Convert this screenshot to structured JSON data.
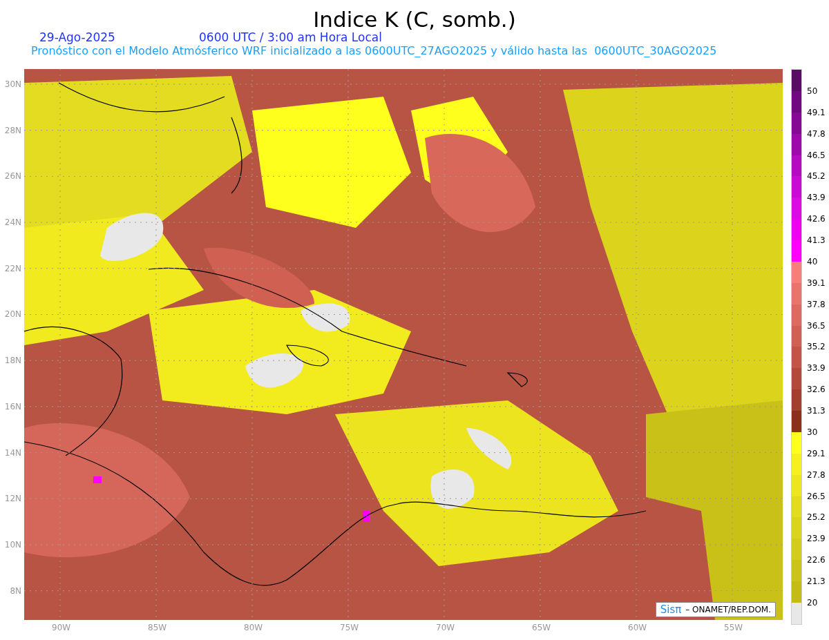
{
  "title": "Indice K (C, somb.)",
  "date": "29-Ago-2025",
  "time": "0600 UTC / 3:00 am Hora Local",
  "subtitle": "Pronóstico con el Modelo Atmósferico WRF inicializado a las 0600UTC_27AGO2025 y válido hasta las  0600UTC_30AGO2025",
  "lat_labels": [
    "30N",
    "28N",
    "26N",
    "24N",
    "22N",
    "20N",
    "18N",
    "16N",
    "14N",
    "12N",
    "10N",
    "8N"
  ],
  "lon_labels": [
    "90W",
    "85W",
    "80W",
    "75W",
    "70W",
    "65W",
    "60W",
    "55W"
  ],
  "colorbar": [
    {
      "color": "#5c0a68",
      "label": "50"
    },
    {
      "color": "#6e0a7e",
      "label": "49.1"
    },
    {
      "color": "#840a94",
      "label": "47.8"
    },
    {
      "color": "#9c0aaa",
      "label": "46.5"
    },
    {
      "color": "#b40ac0",
      "label": "45.2"
    },
    {
      "color": "#ca0ad2",
      "label": "43.9"
    },
    {
      "color": "#de0ae2",
      "label": "42.6"
    },
    {
      "color": "#f000f0",
      "label": "41.3"
    },
    {
      "color": "#ff00ff",
      "label": "40"
    },
    {
      "color": "#f5807a",
      "label": "39.1"
    },
    {
      "color": "#e8756c",
      "label": "37.8"
    },
    {
      "color": "#dc6a60",
      "label": "36.5"
    },
    {
      "color": "#cf6054",
      "label": "35.2"
    },
    {
      "color": "#c25548",
      "label": "33.9"
    },
    {
      "color": "#b24a3c",
      "label": "32.6"
    },
    {
      "color": "#a24030",
      "label": "31.3"
    },
    {
      "color": "#8a3218",
      "label": "30"
    },
    {
      "color": "#ffff1e",
      "label": "29.1"
    },
    {
      "color": "#f5f01e",
      "label": "27.8"
    },
    {
      "color": "#ece61e",
      "label": "26.5"
    },
    {
      "color": "#e2dc1c",
      "label": "25.2"
    },
    {
      "color": "#dad41a",
      "label": "23.9"
    },
    {
      "color": "#d2cc1a",
      "label": "22.6"
    },
    {
      "color": "#cbc418",
      "label": "21.3"
    },
    {
      "color": "#c4bc15",
      "label": "20"
    },
    {
      "color": "#e8e8e8"
    }
  ],
  "credit": {
    "logo": "Sisπ",
    "text": "– ONAMET/REP.DOM."
  }
}
